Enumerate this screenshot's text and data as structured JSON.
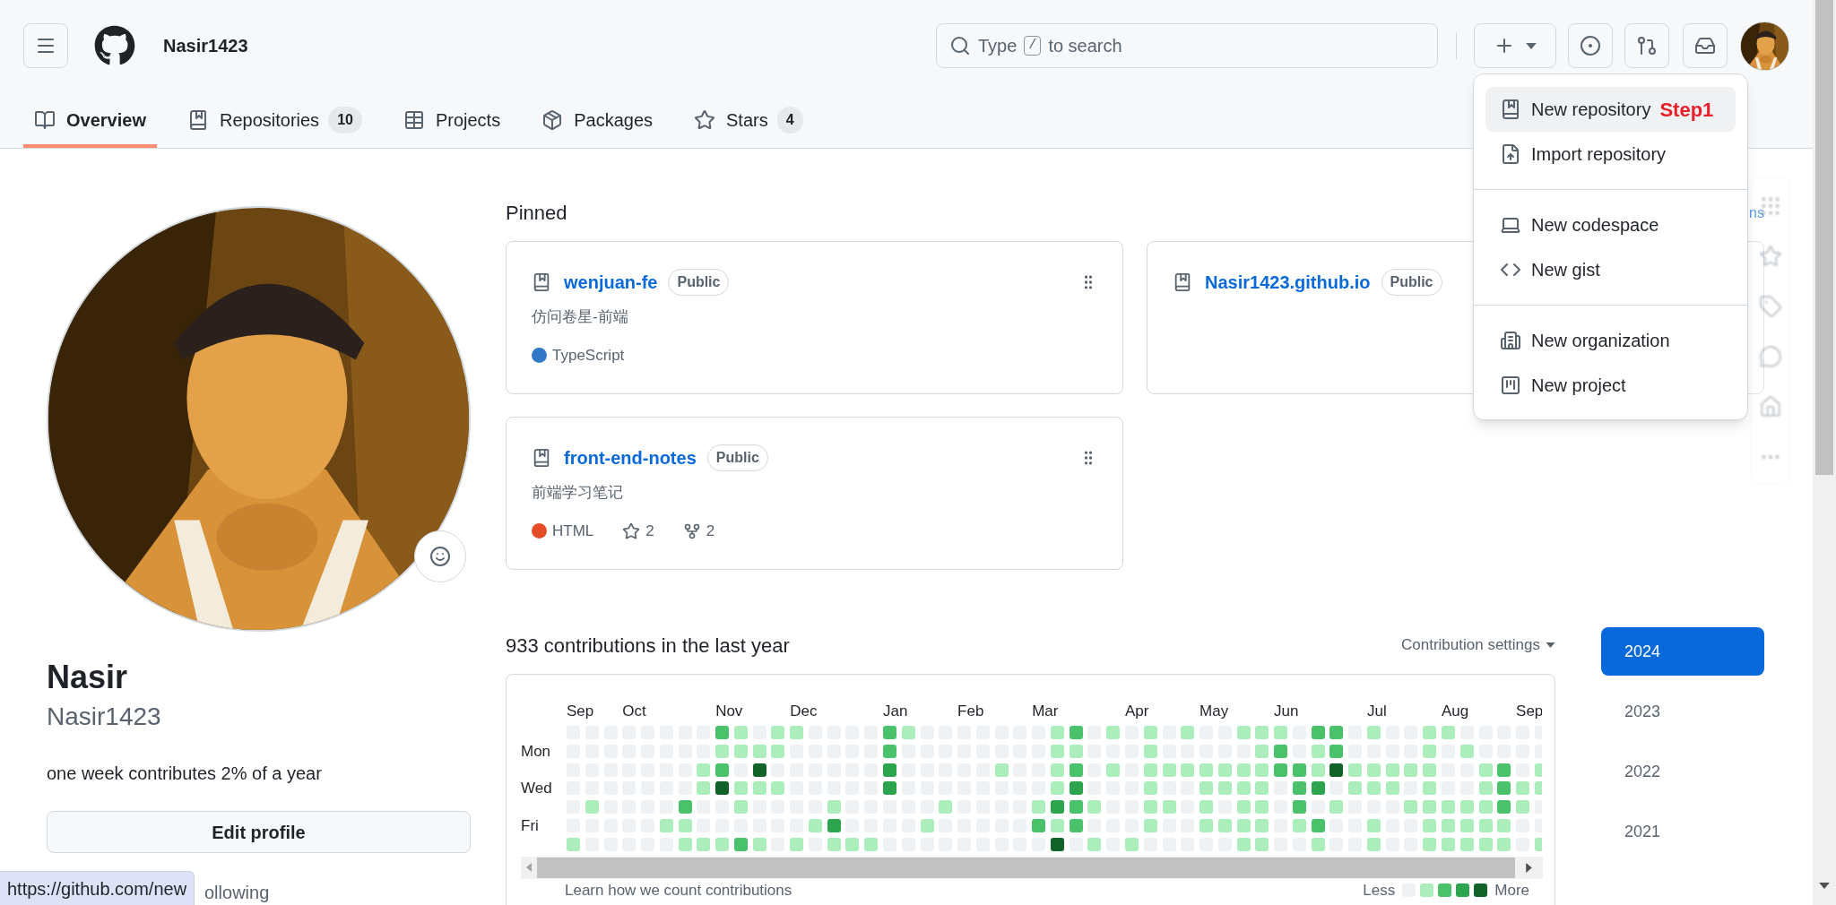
{
  "header": {
    "username": "Nasir1423",
    "search": {
      "prefix": "Type",
      "key": "/",
      "suffix": "to search"
    }
  },
  "tabs": [
    {
      "label": "Overview",
      "selected": true
    },
    {
      "label": "Repositories",
      "count": "10",
      "selected": false
    },
    {
      "label": "Projects",
      "selected": false
    },
    {
      "label": "Packages",
      "selected": false
    },
    {
      "label": "Stars",
      "count": "4",
      "selected": false
    }
  ],
  "menu": {
    "groups": [
      {
        "items": [
          {
            "label": "New repository",
            "highlighted": true,
            "annotation": "Step1"
          },
          {
            "label": "Import repository",
            "highlighted": false
          }
        ]
      },
      {
        "items": [
          {
            "label": "New codespace",
            "highlighted": false
          },
          {
            "label": "New gist",
            "highlighted": false
          }
        ]
      },
      {
        "items": [
          {
            "label": "New organization",
            "highlighted": false
          },
          {
            "label": "New project",
            "highlighted": false
          }
        ]
      }
    ]
  },
  "profile": {
    "name": "Nasir",
    "login": "Nasir1423",
    "bio": "one week contributes 2% of a year",
    "edit_button": "Edit profile",
    "following": "ollowing"
  },
  "pinned": {
    "title": "Pinned",
    "customize_link": "ns",
    "cards": [
      {
        "name": "wenjuan-fe",
        "visibility": "Public",
        "description": "仿问卷星-前端",
        "language": "TypeScript",
        "color": "#3178c6",
        "handle": true
      },
      {
        "name": "Nasir1423.github.io",
        "visibility": "Public"
      },
      {
        "name": "front-end-notes",
        "visibility": "Public",
        "description": "前端学习笔记",
        "language": "HTML",
        "color": "#e34c26",
        "stars": "2",
        "forks": "2",
        "handle": true
      }
    ]
  },
  "graph": {
    "title": "933 contributions in the last year",
    "settings": "Contribution settings",
    "months": [
      "Sep",
      "Oct",
      "Nov",
      "Dec",
      "Jan",
      "Feb",
      "Mar",
      "Apr",
      "May",
      "Jun",
      "Jul",
      "Aug",
      "Sep"
    ],
    "rows": [
      {
        "cells": [
          {
            "color": "#eff2f5"
          },
          {
            "color": "#eff2f5"
          },
          {
            "color": "#eff2f5"
          },
          {
            "color": "#eff2f5"
          },
          {
            "color": "#eff2f5"
          },
          {
            "color": "#eff2f5"
          },
          {
            "color": "#eff2f5"
          },
          {
            "color": "#eff2f5"
          },
          {
            "color": "#4ac26b"
          },
          {
            "color": "#aceebb"
          },
          {
            "color": "#eff2f5"
          },
          {
            "color": "#aceebb"
          },
          {
            "color": "#aceebb"
          },
          {
            "color": "#eff2f5"
          },
          {
            "color": "#eff2f5"
          },
          {
            "color": "#eff2f5"
          },
          {
            "color": "#eff2f5"
          },
          {
            "color": "#4ac26b"
          },
          {
            "color": "#aceebb"
          },
          {
            "color": "#eff2f5"
          },
          {
            "color": "#eff2f5"
          },
          {
            "color": "#eff2f5"
          },
          {
            "color": "#eff2f5"
          },
          {
            "color": "#eff2f5"
          },
          {
            "color": "#eff2f5"
          },
          {
            "color": "#eff2f5"
          },
          {
            "color": "#aceebb"
          },
          {
            "color": "#4ac26b"
          },
          {
            "color": "#eff2f5"
          },
          {
            "color": "#aceebb"
          },
          {
            "color": "#eff2f5"
          },
          {
            "color": "#aceebb"
          },
          {
            "color": "#eff2f5"
          },
          {
            "color": "#aceebb"
          },
          {
            "color": "#eff2f5"
          },
          {
            "color": "#eff2f5"
          },
          {
            "color": "#aceebb"
          },
          {
            "color": "#aceebb"
          },
          {
            "color": "#aceebb"
          },
          {
            "color": "#eff2f5"
          },
          {
            "color": "#4ac26b"
          },
          {
            "color": "#4ac26b"
          },
          {
            "color": "#eff2f5"
          },
          {
            "color": "#aceebb"
          },
          {
            "color": "#eff2f5"
          },
          {
            "color": "#eff2f5"
          },
          {
            "color": "#aceebb"
          },
          {
            "color": "#aceebb"
          },
          {
            "color": "#eff2f5"
          },
          {
            "color": "#eff2f5"
          },
          {
            "color": "#eff2f5"
          },
          {
            "color": "#eff2f5"
          },
          {
            "color": "#eff2f5"
          }
        ]
      },
      {
        "label": "Mon",
        "cells": [
          {
            "color": "#eff2f5"
          },
          {
            "color": "#eff2f5"
          },
          {
            "color": "#eff2f5"
          },
          {
            "color": "#eff2f5"
          },
          {
            "color": "#eff2f5"
          },
          {
            "color": "#eff2f5"
          },
          {
            "color": "#eff2f5"
          },
          {
            "color": "#eff2f5"
          },
          {
            "color": "#aceebb"
          },
          {
            "color": "#aceebb"
          },
          {
            "color": "#aceebb"
          },
          {
            "color": "#aceebb"
          },
          {
            "color": "#eff2f5"
          },
          {
            "color": "#eff2f5"
          },
          {
            "color": "#eff2f5"
          },
          {
            "color": "#eff2f5"
          },
          {
            "color": "#eff2f5"
          },
          {
            "color": "#4ac26b"
          },
          {
            "color": "#eff2f5"
          },
          {
            "color": "#eff2f5"
          },
          {
            "color": "#eff2f5"
          },
          {
            "color": "#eff2f5"
          },
          {
            "color": "#eff2f5"
          },
          {
            "color": "#eff2f5"
          },
          {
            "color": "#eff2f5"
          },
          {
            "color": "#eff2f5"
          },
          {
            "color": "#aceebb"
          },
          {
            "color": "#aceebb"
          },
          {
            "color": "#eff2f5"
          },
          {
            "color": "#eff2f5"
          },
          {
            "color": "#eff2f5"
          },
          {
            "color": "#aceebb"
          },
          {
            "color": "#eff2f5"
          },
          {
            "color": "#eff2f5"
          },
          {
            "color": "#eff2f5"
          },
          {
            "color": "#eff2f5"
          },
          {
            "color": "#eff2f5"
          },
          {
            "color": "#aceebb"
          },
          {
            "color": "#4ac26b"
          },
          {
            "color": "#eff2f5"
          },
          {
            "color": "#aceebb"
          },
          {
            "color": "#4ac26b"
          },
          {
            "color": "#eff2f5"
          },
          {
            "color": "#eff2f5"
          },
          {
            "color": "#eff2f5"
          },
          {
            "color": "#eff2f5"
          },
          {
            "color": "#aceebb"
          },
          {
            "color": "#eff2f5"
          },
          {
            "color": "#aceebb"
          },
          {
            "color": "#eff2f5"
          },
          {
            "color": "#eff2f5"
          },
          {
            "color": "#eff2f5"
          },
          {
            "color": "#eff2f5"
          }
        ]
      },
      {
        "cells": [
          {
            "color": "#eff2f5"
          },
          {
            "color": "#eff2f5"
          },
          {
            "color": "#eff2f5"
          },
          {
            "color": "#eff2f5"
          },
          {
            "color": "#eff2f5"
          },
          {
            "color": "#eff2f5"
          },
          {
            "color": "#eff2f5"
          },
          {
            "color": "#aceebb"
          },
          {
            "color": "#4ac26b"
          },
          {
            "color": "#eff2f5"
          },
          {
            "color": "#116329"
          },
          {
            "color": "#eff2f5"
          },
          {
            "color": "#eff2f5"
          },
          {
            "color": "#eff2f5"
          },
          {
            "color": "#eff2f5"
          },
          {
            "color": "#eff2f5"
          },
          {
            "color": "#eff2f5"
          },
          {
            "color": "#2da44e"
          },
          {
            "color": "#eff2f5"
          },
          {
            "color": "#eff2f5"
          },
          {
            "color": "#eff2f5"
          },
          {
            "color": "#eff2f5"
          },
          {
            "color": "#eff2f5"
          },
          {
            "color": "#aceebb"
          },
          {
            "color": "#eff2f5"
          },
          {
            "color": "#eff2f5"
          },
          {
            "color": "#aceebb"
          },
          {
            "color": "#4ac26b"
          },
          {
            "color": "#eff2f5"
          },
          {
            "color": "#aceebb"
          },
          {
            "color": "#eff2f5"
          },
          {
            "color": "#aceebb"
          },
          {
            "color": "#aceebb"
          },
          {
            "color": "#aceebb"
          },
          {
            "color": "#aceebb"
          },
          {
            "color": "#aceebb"
          },
          {
            "color": "#aceebb"
          },
          {
            "color": "#aceebb"
          },
          {
            "color": "#4ac26b"
          },
          {
            "color": "#4ac26b"
          },
          {
            "color": "#aceebb"
          },
          {
            "color": "#116329"
          },
          {
            "color": "#aceebb"
          },
          {
            "color": "#aceebb"
          },
          {
            "color": "#aceebb"
          },
          {
            "color": "#aceebb"
          },
          {
            "color": "#aceebb"
          },
          {
            "color": "#eff2f5"
          },
          {
            "color": "#eff2f5"
          },
          {
            "color": "#aceebb"
          },
          {
            "color": "#4ac26b"
          },
          {
            "color": "#eff2f5"
          },
          {
            "color": "#aceebb"
          }
        ]
      },
      {
        "label": "Wed",
        "cells": [
          {
            "color": "#eff2f5"
          },
          {
            "color": "#eff2f5"
          },
          {
            "color": "#eff2f5"
          },
          {
            "color": "#eff2f5"
          },
          {
            "color": "#eff2f5"
          },
          {
            "color": "#eff2f5"
          },
          {
            "color": "#eff2f5"
          },
          {
            "color": "#aceebb"
          },
          {
            "color": "#116329"
          },
          {
            "color": "#aceebb"
          },
          {
            "color": "#aceebb"
          },
          {
            "color": "#aceebb"
          },
          {
            "color": "#eff2f5"
          },
          {
            "color": "#eff2f5"
          },
          {
            "color": "#eff2f5"
          },
          {
            "color": "#eff2f5"
          },
          {
            "color": "#eff2f5"
          },
          {
            "color": "#2da44e"
          },
          {
            "color": "#eff2f5"
          },
          {
            "color": "#eff2f5"
          },
          {
            "color": "#eff2f5"
          },
          {
            "color": "#eff2f5"
          },
          {
            "color": "#eff2f5"
          },
          {
            "color": "#eff2f5"
          },
          {
            "color": "#eff2f5"
          },
          {
            "color": "#eff2f5"
          },
          {
            "color": "#aceebb"
          },
          {
            "color": "#2da44e"
          },
          {
            "color": "#eff2f5"
          },
          {
            "color": "#eff2f5"
          },
          {
            "color": "#eff2f5"
          },
          {
            "color": "#aceebb"
          },
          {
            "color": "#eff2f5"
          },
          {
            "color": "#eff2f5"
          },
          {
            "color": "#aceebb"
          },
          {
            "color": "#aceebb"
          },
          {
            "color": "#aceebb"
          },
          {
            "color": "#aceebb"
          },
          {
            "color": "#eff2f5"
          },
          {
            "color": "#4ac26b"
          },
          {
            "color": "#2da44e"
          },
          {
            "color": "#eff2f5"
          },
          {
            "color": "#aceebb"
          },
          {
            "color": "#aceebb"
          },
          {
            "color": "#aceebb"
          },
          {
            "color": "#eff2f5"
          },
          {
            "color": "#aceebb"
          },
          {
            "color": "#eff2f5"
          },
          {
            "color": "#eff2f5"
          },
          {
            "color": "#aceebb"
          },
          {
            "color": "#4ac26b"
          },
          {
            "color": "#aceebb"
          },
          {
            "color": "#aceebb"
          }
        ]
      },
      {
        "cells": [
          {
            "color": "#eff2f5"
          },
          {
            "color": "#aceebb"
          },
          {
            "color": "#eff2f5"
          },
          {
            "color": "#eff2f5"
          },
          {
            "color": "#eff2f5"
          },
          {
            "color": "#eff2f5"
          },
          {
            "color": "#4ac26b"
          },
          {
            "color": "#eff2f5"
          },
          {
            "color": "#eff2f5"
          },
          {
            "color": "#aceebb"
          },
          {
            "color": "#eff2f5"
          },
          {
            "color": "#eff2f5"
          },
          {
            "color": "#eff2f5"
          },
          {
            "color": "#eff2f5"
          },
          {
            "color": "#aceebb"
          },
          {
            "color": "#eff2f5"
          },
          {
            "color": "#eff2f5"
          },
          {
            "color": "#eff2f5"
          },
          {
            "color": "#eff2f5"
          },
          {
            "color": "#eff2f5"
          },
          {
            "color": "#aceebb"
          },
          {
            "color": "#eff2f5"
          },
          {
            "color": "#eff2f5"
          },
          {
            "color": "#eff2f5"
          },
          {
            "color": "#eff2f5"
          },
          {
            "color": "#aceebb"
          },
          {
            "color": "#2da44e"
          },
          {
            "color": "#4ac26b"
          },
          {
            "color": "#aceebb"
          },
          {
            "color": "#eff2f5"
          },
          {
            "color": "#eff2f5"
          },
          {
            "color": "#aceebb"
          },
          {
            "color": "#aceebb"
          },
          {
            "color": "#eff2f5"
          },
          {
            "color": "#aceebb"
          },
          {
            "color": "#eff2f5"
          },
          {
            "color": "#aceebb"
          },
          {
            "color": "#aceebb"
          },
          {
            "color": "#eff2f5"
          },
          {
            "color": "#4ac26b"
          },
          {
            "color": "#eff2f5"
          },
          {
            "color": "#aceebb"
          },
          {
            "color": "#eff2f5"
          },
          {
            "color": "#eff2f5"
          },
          {
            "color": "#eff2f5"
          },
          {
            "color": "#aceebb"
          },
          {
            "color": "#aceebb"
          },
          {
            "color": "#aceebb"
          },
          {
            "color": "#aceebb"
          },
          {
            "color": "#aceebb"
          },
          {
            "color": "#4ac26b"
          },
          {
            "color": "#aceebb"
          },
          {
            "color": "#eff2f5"
          }
        ]
      },
      {
        "label": "Fri",
        "cells": [
          {
            "color": "#eff2f5"
          },
          {
            "color": "#eff2f5"
          },
          {
            "color": "#eff2f5"
          },
          {
            "color": "#eff2f5"
          },
          {
            "color": "#eff2f5"
          },
          {
            "color": "#aceebb"
          },
          {
            "color": "#aceebb"
          },
          {
            "color": "#eff2f5"
          },
          {
            "color": "#eff2f5"
          },
          {
            "color": "#eff2f5"
          },
          {
            "color": "#eff2f5"
          },
          {
            "color": "#eff2f5"
          },
          {
            "color": "#eff2f5"
          },
          {
            "color": "#aceebb"
          },
          {
            "color": "#2da44e"
          },
          {
            "color": "#eff2f5"
          },
          {
            "color": "#eff2f5"
          },
          {
            "color": "#eff2f5"
          },
          {
            "color": "#eff2f5"
          },
          {
            "color": "#aceebb"
          },
          {
            "color": "#eff2f5"
          },
          {
            "color": "#eff2f5"
          },
          {
            "color": "#eff2f5"
          },
          {
            "color": "#eff2f5"
          },
          {
            "color": "#eff2f5"
          },
          {
            "color": "#4ac26b"
          },
          {
            "color": "#aceebb"
          },
          {
            "color": "#4ac26b"
          },
          {
            "color": "#eff2f5"
          },
          {
            "color": "#eff2f5"
          },
          {
            "color": "#eff2f5"
          },
          {
            "color": "#aceebb"
          },
          {
            "color": "#eff2f5"
          },
          {
            "color": "#eff2f5"
          },
          {
            "color": "#aceebb"
          },
          {
            "color": "#aceebb"
          },
          {
            "color": "#aceebb"
          },
          {
            "color": "#aceebb"
          },
          {
            "color": "#eff2f5"
          },
          {
            "color": "#aceebb"
          },
          {
            "color": "#4ac26b"
          },
          {
            "color": "#eff2f5"
          },
          {
            "color": "#eff2f5"
          },
          {
            "color": "#aceebb"
          },
          {
            "color": "#eff2f5"
          },
          {
            "color": "#eff2f5"
          },
          {
            "color": "#aceebb"
          },
          {
            "color": "#aceebb"
          },
          {
            "color": "#aceebb"
          },
          {
            "color": "#aceebb"
          },
          {
            "color": "#aceebb"
          },
          {
            "color": "#eff2f5"
          },
          {
            "color": "#eff2f5"
          }
        ]
      },
      {
        "cells": [
          {
            "color": "#aceebb"
          },
          {
            "color": "#eff2f5"
          },
          {
            "color": "#eff2f5"
          },
          {
            "color": "#eff2f5"
          },
          {
            "color": "#eff2f5"
          },
          {
            "color": "#eff2f5"
          },
          {
            "color": "#aceebb"
          },
          {
            "color": "#aceebb"
          },
          {
            "color": "#aceebb"
          },
          {
            "color": "#4ac26b"
          },
          {
            "color": "#aceebb"
          },
          {
            "color": "#eff2f5"
          },
          {
            "color": "#aceebb"
          },
          {
            "color": "#eff2f5"
          },
          {
            "color": "#aceebb"
          },
          {
            "color": "#aceebb"
          },
          {
            "color": "#aceebb"
          },
          {
            "color": "#eff2f5"
          },
          {
            "color": "#eff2f5"
          },
          {
            "color": "#eff2f5"
          },
          {
            "color": "#eff2f5"
          },
          {
            "color": "#eff2f5"
          },
          {
            "color": "#eff2f5"
          },
          {
            "color": "#eff2f5"
          },
          {
            "color": "#eff2f5"
          },
          {
            "color": "#eff2f5"
          },
          {
            "color": "#116329"
          },
          {
            "color": "#eff2f5"
          },
          {
            "color": "#aceebb"
          },
          {
            "color": "#eff2f5"
          },
          {
            "color": "#aceebb"
          },
          {
            "color": "#eff2f5"
          },
          {
            "color": "#eff2f5"
          },
          {
            "color": "#eff2f5"
          },
          {
            "color": "#eff2f5"
          },
          {
            "color": "#eff2f5"
          },
          {
            "color": "#aceebb"
          },
          {
            "color": "#aceebb"
          },
          {
            "color": "#eff2f5"
          },
          {
            "color": "#eff2f5"
          },
          {
            "color": "#aceebb"
          },
          {
            "color": "#eff2f5"
          },
          {
            "color": "#eff2f5"
          },
          {
            "color": "#aceebb"
          },
          {
            "color": "#eff2f5"
          },
          {
            "color": "#eff2f5"
          },
          {
            "color": "#aceebb"
          },
          {
            "color": "#aceebb"
          },
          {
            "color": "#aceebb"
          },
          {
            "color": "#aceebb"
          },
          {
            "color": "#aceebb"
          },
          {
            "color": "#eff2f5"
          },
          {
            "color": "#aceebb"
          }
        ]
      }
    ],
    "footer_link": "Learn how we count contributions",
    "legend": {
      "less": "Less",
      "more": "More",
      "levels": [
        {
          "color": "#eff2f5"
        },
        {
          "color": "#aceebb"
        },
        {
          "color": "#4ac26b"
        },
        {
          "color": "#2da44e"
        },
        {
          "color": "#116329"
        }
      ]
    }
  },
  "years": [
    {
      "label": "2024",
      "selected": true
    },
    {
      "label": "2023",
      "selected": false
    },
    {
      "label": "2022",
      "selected": false
    },
    {
      "label": "2021",
      "selected": false
    }
  ],
  "status_tooltip": "https://github.com/new"
}
